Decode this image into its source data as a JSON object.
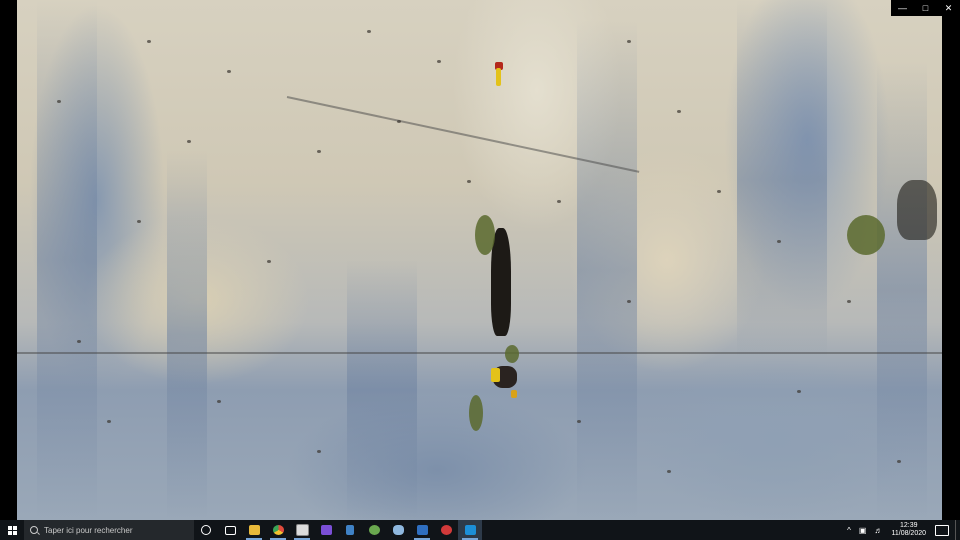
{
  "window": {
    "controls": [
      "—",
      "□",
      "✕"
    ]
  },
  "taskbar": {
    "search_placeholder": "Taper ici pour rechercher",
    "pinned_apps": [
      {
        "name": "cortana-icon",
        "color": "#ffffff"
      },
      {
        "name": "task-view-icon",
        "color": "#ffffff"
      },
      {
        "name": "file-explorer-icon",
        "color": "#e8b93a"
      },
      {
        "name": "chrome-icon",
        "color": "#e04b3c"
      },
      {
        "name": "media-app-icon",
        "color": "#dcdcdc"
      },
      {
        "name": "purple-app-icon",
        "color": "#7b4fd6"
      },
      {
        "name": "calculator-icon",
        "color": "#3f82c6"
      },
      {
        "name": "globe-app-icon",
        "color": "#6aa84f"
      },
      {
        "name": "bird-app-icon",
        "color": "#8fb8de"
      },
      {
        "name": "user-app-icon",
        "color": "#2f6fc0"
      },
      {
        "name": "red-app-icon",
        "color": "#d23a3a"
      },
      {
        "name": "photos-app-icon",
        "color": "#1c8fd8"
      }
    ],
    "tray": {
      "chevron": "^",
      "clock_time": "12:39",
      "clock_date": "11/08/2020"
    }
  },
  "colors": {
    "taskbar_bg": "#101418",
    "accent": "#79a7d9"
  }
}
